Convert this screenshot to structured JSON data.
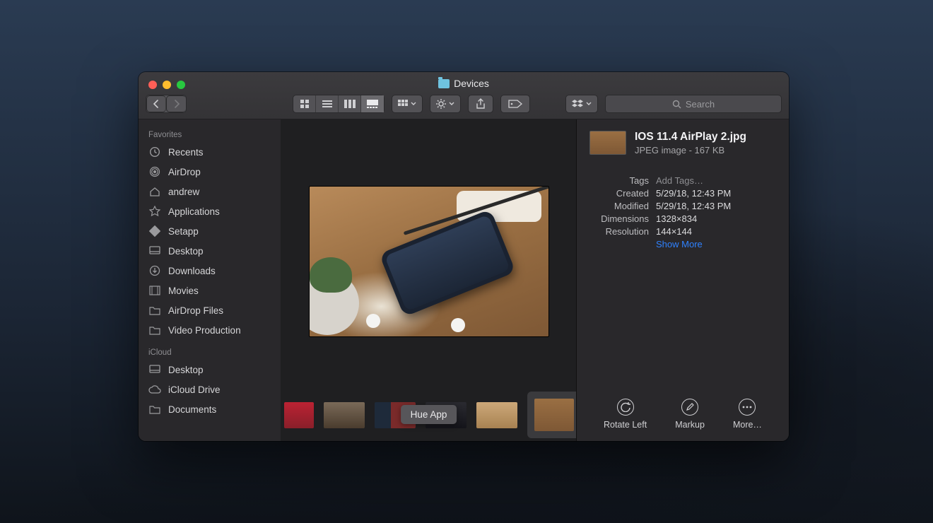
{
  "window": {
    "title": "Devices"
  },
  "toolbar": {
    "search_placeholder": "Search"
  },
  "sidebar": {
    "sections": [
      {
        "header": "Favorites",
        "items": [
          {
            "icon": "clock-icon",
            "label": "Recents"
          },
          {
            "icon": "airdrop-icon",
            "label": "AirDrop"
          },
          {
            "icon": "home-icon",
            "label": "andrew"
          },
          {
            "icon": "apps-icon",
            "label": "Applications"
          },
          {
            "icon": "setapp-icon",
            "label": "Setapp"
          },
          {
            "icon": "desktop-icon",
            "label": "Desktop"
          },
          {
            "icon": "downloads-icon",
            "label": "Downloads"
          },
          {
            "icon": "movies-icon",
            "label": "Movies"
          },
          {
            "icon": "folder-icon",
            "label": "AirDrop Files"
          },
          {
            "icon": "folder-icon",
            "label": "Video Production"
          }
        ]
      },
      {
        "header": "iCloud",
        "items": [
          {
            "icon": "desktop-icon",
            "label": "Desktop"
          },
          {
            "icon": "cloud-icon",
            "label": "iCloud Drive"
          },
          {
            "icon": "folder-icon",
            "label": "Documents"
          }
        ]
      }
    ]
  },
  "gallery": {
    "tooltip": "Hue App",
    "thumbs": [
      "t0",
      "t1",
      "t2",
      "t3",
      "t4",
      "sel"
    ]
  },
  "info": {
    "filename": "IOS 11.4 AirPlay 2.jpg",
    "subtitle": "JPEG image - 167 KB",
    "meta": {
      "tags_label": "Tags",
      "tags_value": "Add Tags…",
      "created_label": "Created",
      "created_value": "5/29/18, 12:43 PM",
      "modified_label": "Modified",
      "modified_value": "5/29/18, 12:43 PM",
      "dimensions_label": "Dimensions",
      "dimensions_value": "1328×834",
      "resolution_label": "Resolution",
      "resolution_value": "144×144",
      "show_more": "Show More"
    }
  },
  "actions": {
    "rotate": "Rotate Left",
    "markup": "Markup",
    "more": "More…"
  }
}
